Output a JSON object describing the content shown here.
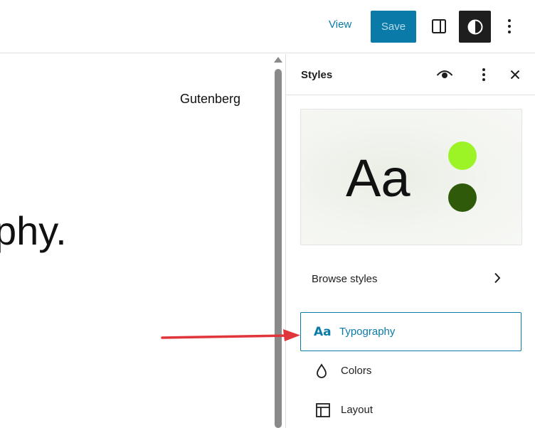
{
  "toolbar": {
    "view_label": "View",
    "save_label": "Save",
    "icons": [
      "sidebar-toggle-icon",
      "half-contrast-icon",
      "vertical-ellipsis-icon"
    ]
  },
  "canvas": {
    "site_title": "Gutenberg",
    "hero_fragment": "phy."
  },
  "sidebar": {
    "title": "Styles",
    "header_icons": [
      "eye-icon",
      "vertical-ellipsis-icon",
      "close-icon"
    ],
    "preview": {
      "sample_text": "Aa",
      "swatches": [
        "#9cf427",
        "#2f5a0a"
      ]
    },
    "browse_styles_label": "Browse styles",
    "items": [
      {
        "label": "Typography",
        "icon": "aa-icon",
        "highlighted": true
      },
      {
        "label": "Colors",
        "icon": "droplet-icon"
      },
      {
        "label": "Layout",
        "icon": "layout-icon"
      }
    ]
  },
  "colors": {
    "accent": "#0a7aa8",
    "annotation_arrow": "#e0353a"
  }
}
